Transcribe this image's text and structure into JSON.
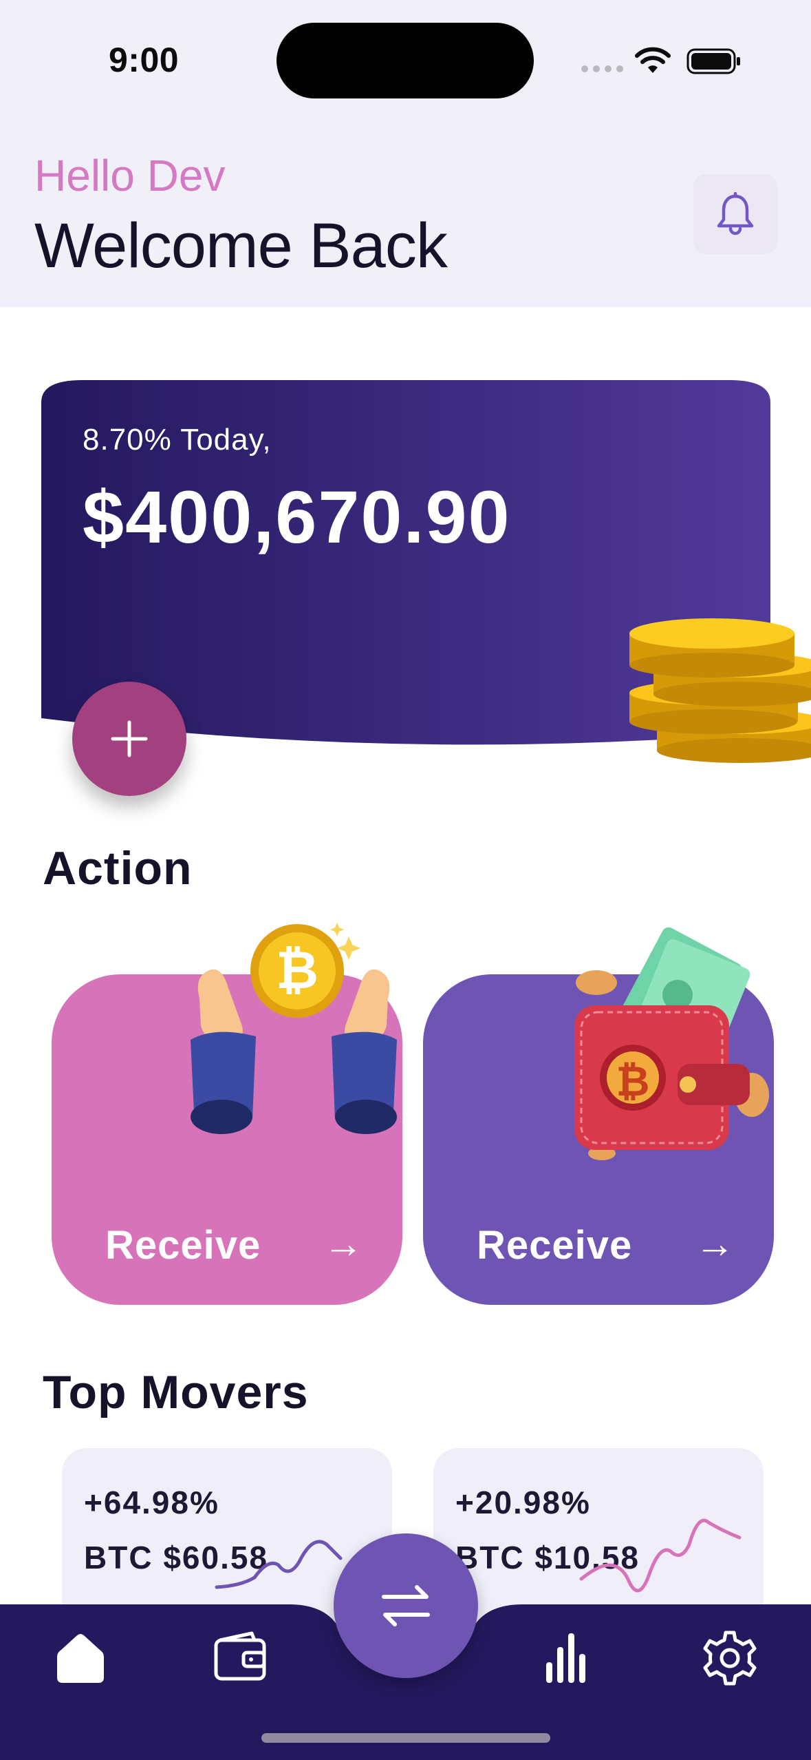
{
  "status_bar": {
    "time": "9:00"
  },
  "header": {
    "greeting": "Hello Dev",
    "title": "Welcome Back",
    "notification_icon": "bell-icon"
  },
  "balance_card": {
    "change_text": "8.70% Today,",
    "balance": "$400,670.90",
    "add_icon": "plus-icon"
  },
  "actions": {
    "title": "Action",
    "items": [
      {
        "label": "Receive",
        "arrow": "→",
        "color": "#d774b9"
      },
      {
        "label": "Receive",
        "arrow": "→",
        "color": "#6f55b3"
      }
    ]
  },
  "top_movers": {
    "title": "Top Movers",
    "items": [
      {
        "change": "+64.98%",
        "value": "BTC $60.58",
        "trend_color": "#6f55b3"
      },
      {
        "change": "+20.98%",
        "value": "BTC $10.58",
        "trend_color": "#d774b9"
      }
    ]
  },
  "tab_bar": {
    "items": [
      "home-icon",
      "wallet-icon",
      "swap-icon",
      "chart-icon",
      "settings-icon"
    ],
    "active": "home-icon"
  },
  "colors": {
    "brand_dark": "#24195f",
    "brand_purple": "#6f55b3",
    "accent_pink": "#d774b9",
    "header_bg": "#f1eff8"
  }
}
